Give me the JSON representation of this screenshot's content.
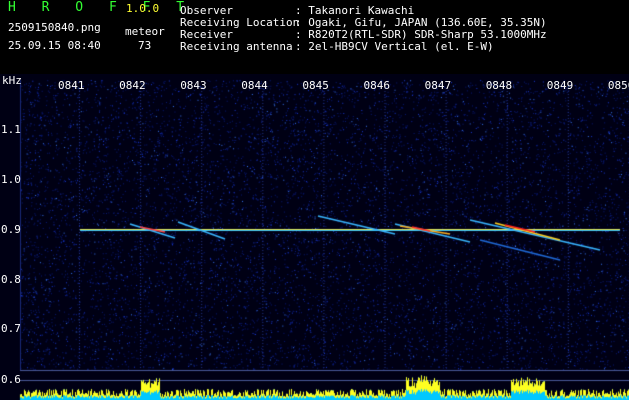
{
  "app": {
    "name": "H R O F F T",
    "version": "1.0.0"
  },
  "file": {
    "name": "2509150840.png",
    "datetime": "25.09.15 08:40"
  },
  "meteor": {
    "label": "meteor",
    "count": "73"
  },
  "info": [
    {
      "key": "Observer",
      "value": ": Takanori Kawachi"
    },
    {
      "key": "Receiving Location",
      "value": ": Ogaki, Gifu, JAPAN (136.60E, 35.35N)"
    },
    {
      "key": "Receiver",
      "value": ": R820T2(RTL-SDR) SDR-Sharp 53.1000MHz"
    },
    {
      "key": "Receiving antenna",
      "value": ": 2el-HB9CV Vertical (el. E-W)"
    }
  ],
  "axes": {
    "y_unit": "kHz",
    "x_ticks": [
      "0841",
      "0842",
      "0843",
      "0844",
      "0845",
      "0846",
      "0847",
      "0848",
      "0849",
      "0850"
    ],
    "y_ticks": [
      "1.1",
      "1.0",
      "0.9",
      "0.8",
      "0.7",
      "0.6"
    ]
  },
  "colors": {
    "header_text": "#ffffff",
    "title": "#33ff33",
    "version": "#ffff33",
    "background": "#000000"
  }
}
